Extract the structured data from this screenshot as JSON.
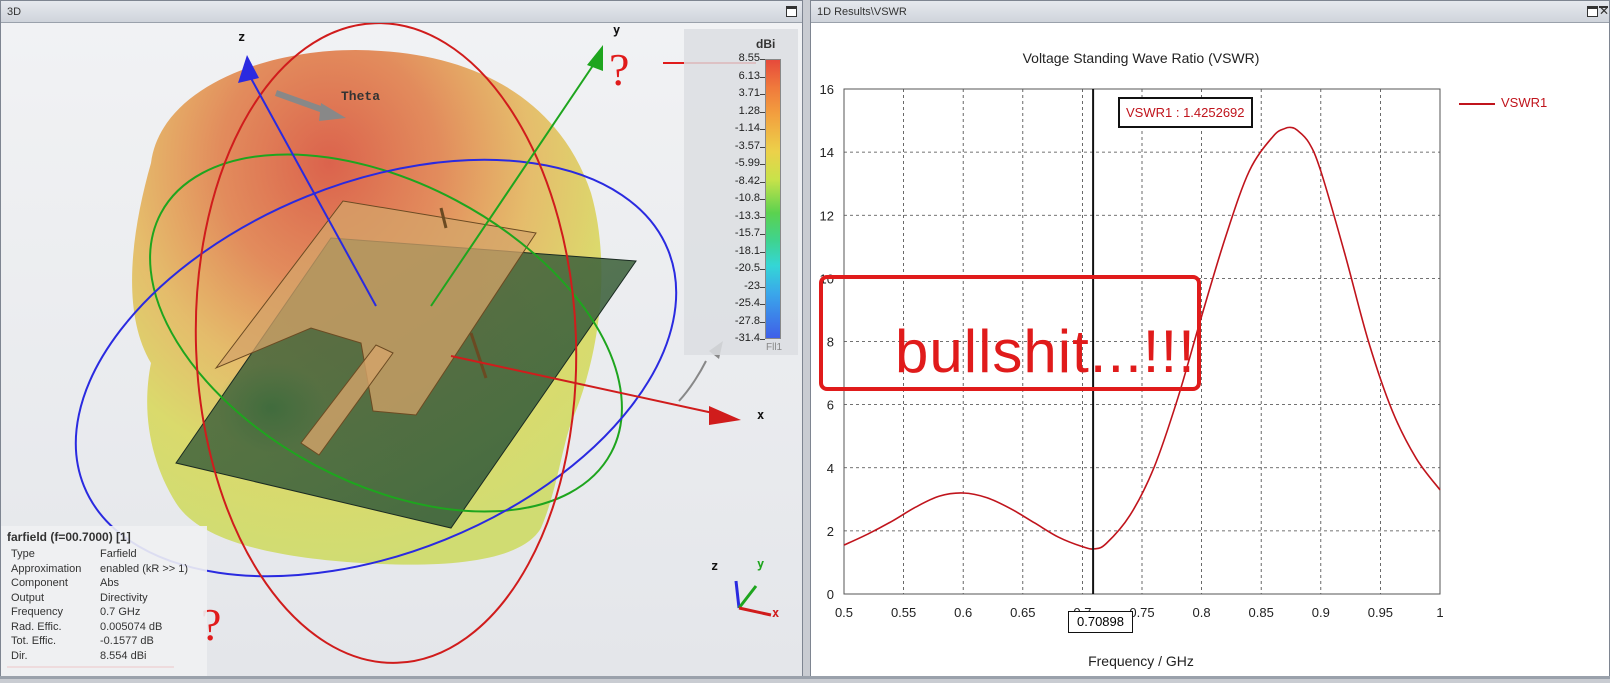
{
  "left_panel": {
    "title": "3D",
    "colorbar": {
      "unit_title": "dBi",
      "ticks": [
        "8.55",
        "6.13",
        "3.71",
        "1.28",
        "-1.14",
        "-3.57",
        "-5.99",
        "-8.42",
        "-10.8",
        "-13.3",
        "-15.7",
        "-18.1",
        "-20.5",
        "-23",
        "-25.4",
        "-27.8",
        "-31.4"
      ],
      "bottom_label": "Fll1"
    },
    "axes": {
      "z": "z",
      "y": "y",
      "x": "x",
      "theta": "Theta"
    },
    "mini_axes": {
      "z": "z",
      "y": "y",
      "x": "x"
    },
    "info": {
      "title": "farfield (f=00.7000) [1]",
      "rows": [
        {
          "key": "Type",
          "value": "Farfield"
        },
        {
          "key": "Approximation",
          "value": "enabled (kR >> 1)"
        },
        {
          "key": "Component",
          "value": "Abs"
        },
        {
          "key": "Output",
          "value": "Directivity"
        },
        {
          "key": "Frequency",
          "value": "0.7 GHz"
        },
        {
          "key": "Rad. Effic.",
          "value": "0.005074 dB"
        },
        {
          "key": "Tot. Effic.",
          "value": "-0.1577 dB"
        },
        {
          "key": "Dir.",
          "value": "8.554 dBi"
        }
      ]
    },
    "annotations": {
      "question_mark": "?"
    }
  },
  "right_panel": {
    "title": "1D Results\\VSWR",
    "marker_label": "VSWR1 : 1.4252692",
    "cursor_value": "0.70898",
    "annotation_text": "bullshit...!!!",
    "legend": "VSWR1",
    "accent_color": "#c0141c"
  },
  "chart_data": {
    "type": "line",
    "title": "Voltage Standing Wave Ratio (VSWR)",
    "xlabel": "Frequency / GHz",
    "ylabel": "",
    "xlim": [
      0.5,
      1.0
    ],
    "ylim": [
      0,
      16
    ],
    "xticks": [
      "0.5",
      "0.55",
      "0.6",
      "0.65",
      "0.7",
      "0.75",
      "0.8",
      "0.85",
      "0.9",
      "0.95",
      "1"
    ],
    "yticks": [
      "0",
      "2",
      "4",
      "6",
      "8",
      "10",
      "12",
      "14",
      "16"
    ],
    "grid": true,
    "legend_position": "top-right",
    "cursor_x": 0.70898,
    "series": [
      {
        "name": "VSWR1",
        "color": "#c0141c",
        "x": [
          0.5,
          0.52,
          0.54,
          0.56,
          0.58,
          0.6,
          0.62,
          0.64,
          0.66,
          0.68,
          0.7,
          0.71,
          0.72,
          0.74,
          0.76,
          0.78,
          0.8,
          0.82,
          0.84,
          0.86,
          0.87,
          0.875,
          0.88,
          0.89,
          0.9,
          0.92,
          0.94,
          0.96,
          0.98,
          1.0
        ],
        "values": [
          1.55,
          1.9,
          2.3,
          2.75,
          3.1,
          3.2,
          3.05,
          2.7,
          2.25,
          1.8,
          1.5,
          1.43,
          1.6,
          2.5,
          4.0,
          6.2,
          8.8,
          11.3,
          13.4,
          14.5,
          14.75,
          14.78,
          14.7,
          14.3,
          13.4,
          10.8,
          8.0,
          5.8,
          4.3,
          3.3
        ]
      }
    ]
  }
}
